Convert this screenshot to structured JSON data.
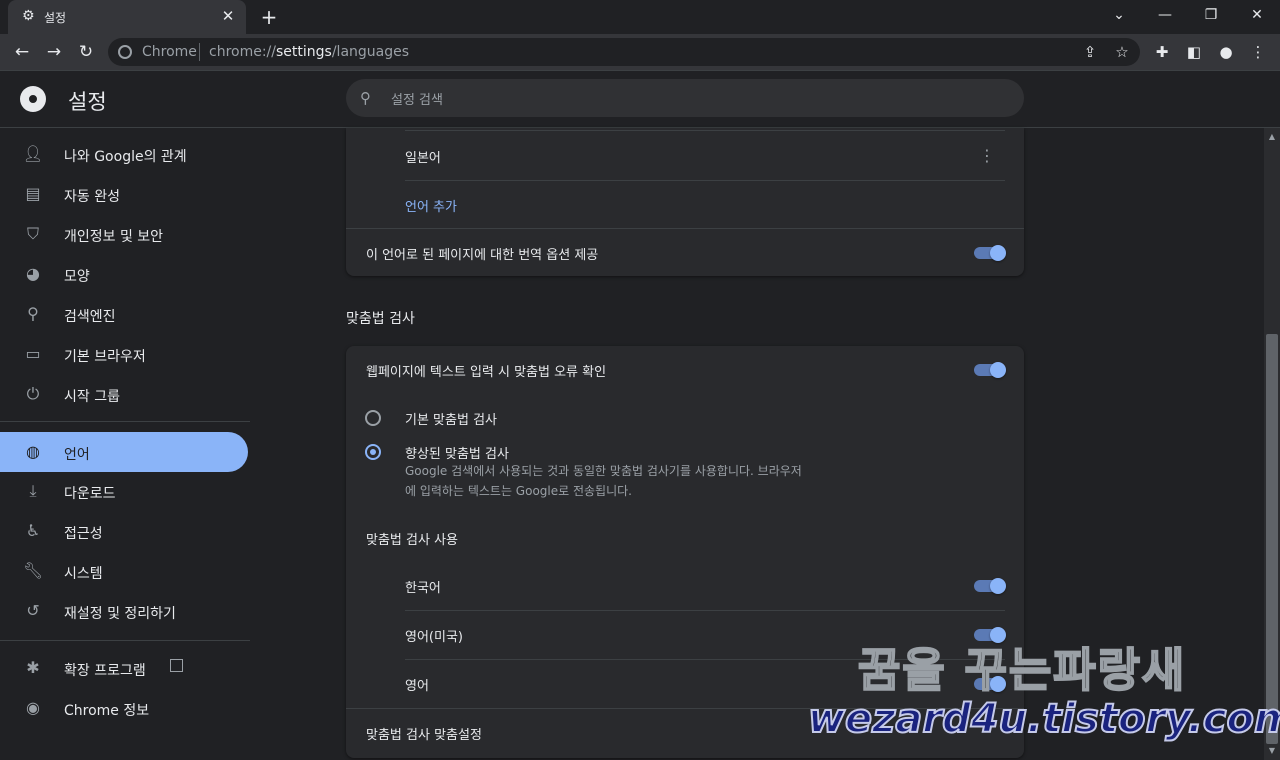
{
  "tab": {
    "title": "설정"
  },
  "omnibox": {
    "site_label": "Chrome",
    "url_prefix": "chrome://",
    "url_host": "settings",
    "url_path": "/languages"
  },
  "header": {
    "title": "설정",
    "search_placeholder": "설정 검색"
  },
  "sidebar": {
    "items": [
      {
        "label": "나와 Google의 관계",
        "icon": "person-icon"
      },
      {
        "label": "자동 완성",
        "icon": "clipboard-icon"
      },
      {
        "label": "개인정보 및 보안",
        "icon": "shield-icon"
      },
      {
        "label": "모양",
        "icon": "palette-icon"
      },
      {
        "label": "검색엔진",
        "icon": "search-icon"
      },
      {
        "label": "기본 브라우저",
        "icon": "browser-icon"
      },
      {
        "label": "시작 그룹",
        "icon": "power-icon"
      },
      {
        "label": "언어",
        "icon": "globe-icon",
        "active": true
      },
      {
        "label": "다운로드",
        "icon": "download-icon"
      },
      {
        "label": "접근성",
        "icon": "accessibility-icon"
      },
      {
        "label": "시스템",
        "icon": "wrench-icon"
      },
      {
        "label": "재설정 및 정리하기",
        "icon": "restore-icon"
      },
      {
        "label": "확장 프로그램",
        "icon": "puzzle-icon"
      },
      {
        "label": "Chrome 정보",
        "icon": "chrome-icon"
      }
    ]
  },
  "languages_card": {
    "language": "일본어",
    "add_language": "언어 추가",
    "offer_translate": "이 언어로 된 페이지에 대한 번역 옵션 제공",
    "offer_translate_on": true
  },
  "spellcheck": {
    "section_title": "맞춤법 검사",
    "check_label": "웹페이지에 텍스트 입력 시 맞춤법 오류 확인",
    "check_on": true,
    "basic_label": "기본 맞춤법 검사",
    "enhanced_label": "향상된 맞춤법 검사",
    "enhanced_desc_1": "Google 검색에서 사용되는 것과 동일한 맞춤법 검사기를 사용합니다. 브라우저",
    "enhanced_desc_2": "에 입력하는 텍스트는 Google로 전송됩니다.",
    "selected": "enhanced",
    "use_title": "맞춤법 검사 사용",
    "languages": [
      {
        "label": "한국어",
        "on": true
      },
      {
        "label": "영어(미국)",
        "on": true
      },
      {
        "label": "영어",
        "on": true
      }
    ],
    "custom_label": "맞춤법 검사 맞춤설정"
  },
  "watermark": {
    "line1": "꿈을 꾸는파랑새",
    "line2": "wezard4u.tistory.com"
  }
}
